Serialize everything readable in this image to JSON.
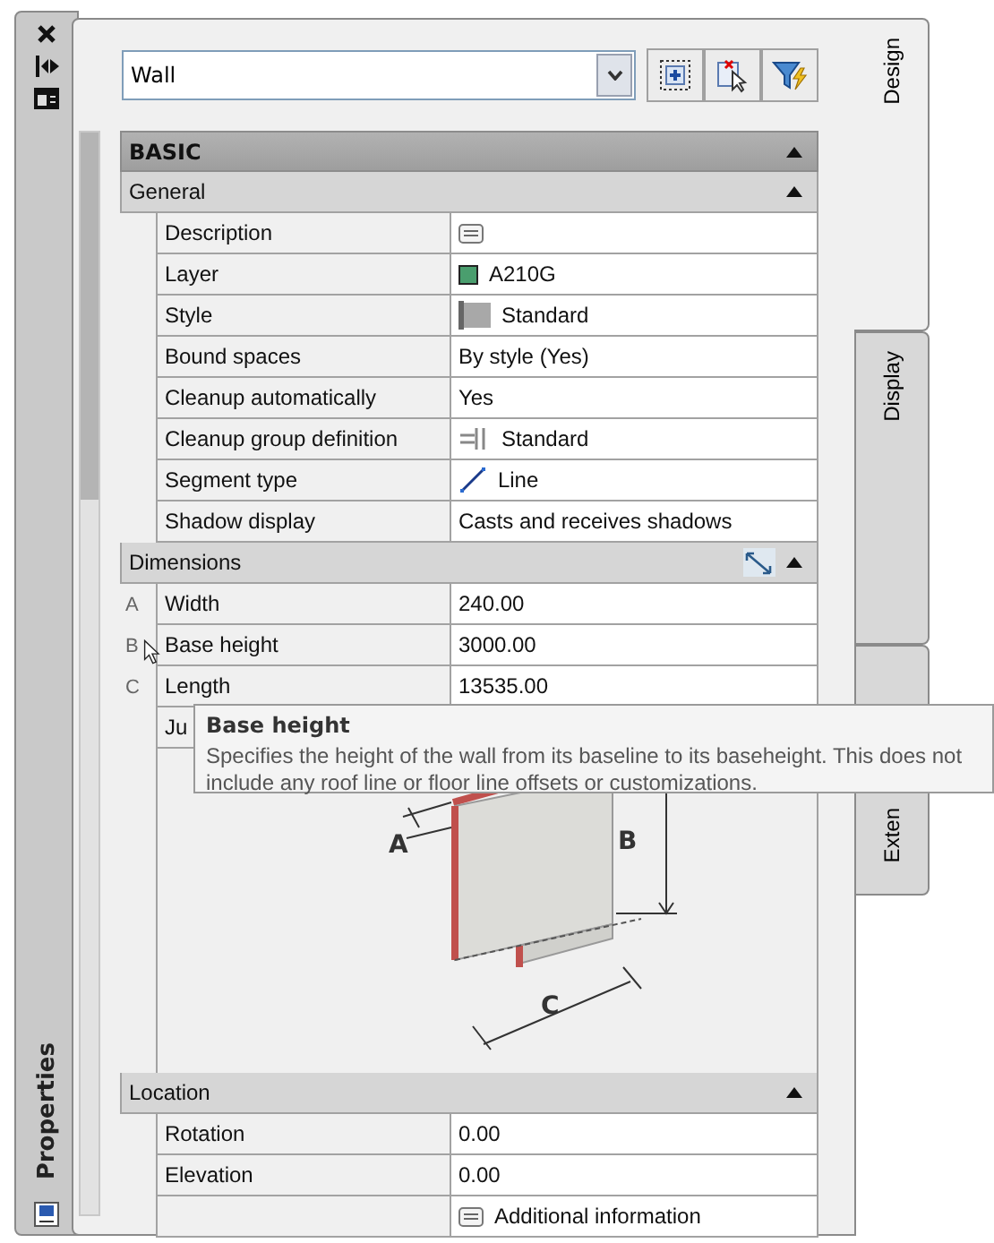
{
  "sidebar": {
    "title": "Properties"
  },
  "toolbar": {
    "object_type": "Wall"
  },
  "categories": [
    {
      "title": "BASIC",
      "expanded": true,
      "groups": [
        {
          "title": "General",
          "expanded": true,
          "rows": [
            {
              "label": "Description",
              "kind": "description"
            },
            {
              "label": "Layer",
              "value": "A210G",
              "kind": "layer",
              "color": "#4a9e6e"
            },
            {
              "label": "Style",
              "value": "Standard",
              "kind": "style"
            },
            {
              "label": "Bound spaces",
              "value": "By style (Yes)",
              "kind": "text"
            },
            {
              "label": "Cleanup automatically",
              "value": "Yes",
              "kind": "text"
            },
            {
              "label": "Cleanup group definition",
              "value": "Standard",
              "kind": "cleanup"
            },
            {
              "label": "Segment type",
              "value": "Line",
              "kind": "segment"
            },
            {
              "label": "Shadow display",
              "value": "Casts and receives shadows",
              "kind": "text"
            }
          ]
        },
        {
          "title": "Dimensions",
          "expanded": true,
          "has_dimension_tool": true,
          "rows": [
            {
              "marker": "A",
              "label": "Width",
              "value": "240.00",
              "kind": "text"
            },
            {
              "marker": "B",
              "label": "Base height",
              "value": "3000.00",
              "kind": "text"
            },
            {
              "marker": "C",
              "label": "Length",
              "value": "13535.00",
              "kind": "text"
            },
            {
              "label": "Ju",
              "kind": "text"
            }
          ],
          "diagram": {
            "labels": [
              "A",
              "B",
              "C"
            ]
          }
        },
        {
          "title": "Location",
          "expanded": true,
          "rows": [
            {
              "label": "Rotation",
              "value": "0.00",
              "kind": "text"
            },
            {
              "label": "Elevation",
              "value": "0.00",
              "kind": "text"
            },
            {
              "value": "Additional information",
              "kind": "description"
            }
          ]
        }
      ]
    }
  ],
  "tabs": [
    {
      "label": "Design",
      "selected": true
    },
    {
      "label": "Display",
      "selected": false
    },
    {
      "label": "Exten",
      "selected": false
    }
  ],
  "tooltip": {
    "title": "Base height",
    "text": "Specifies the height of the wall from its baseline to its baseheight.  This does not include any roof line or floor line offsets or customizations."
  }
}
